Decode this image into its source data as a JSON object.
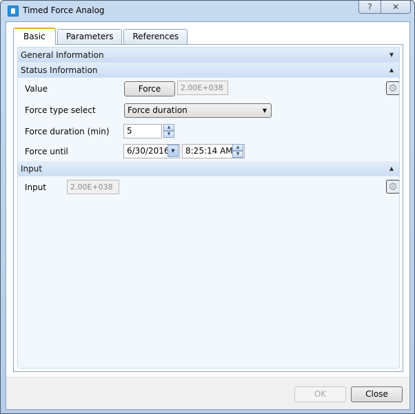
{
  "window": {
    "title": "Timed Force Analog",
    "icon": "app-icon",
    "help_label": "?",
    "close_label": "✕"
  },
  "tabs": [
    {
      "label": "Basic",
      "active": true
    },
    {
      "label": "Parameters",
      "active": false
    },
    {
      "label": "References",
      "active": false
    }
  ],
  "sections": {
    "general": {
      "title": "General Information",
      "state": "collapsed",
      "chevron": "▼"
    },
    "status": {
      "title": "Status Information",
      "state": "expanded",
      "chevron": "▲",
      "value_label": "Value",
      "force_button": "Force",
      "value_field": "2.00E+038",
      "force_type_label": "Force type select",
      "force_type_value": "Force duration",
      "force_duration_label": "Force duration (min)",
      "force_duration_value": "5",
      "force_until_label": "Force until",
      "force_until_date": "6/30/2016",
      "force_until_time": "8:25:14 AM"
    },
    "input": {
      "title": "Input",
      "state": "expanded",
      "chevron": "▲",
      "input_label": "Input",
      "input_value": "2.00E+038"
    }
  },
  "footer": {
    "ok_label": "OK",
    "close_label": "Close"
  },
  "icons": {
    "gear": "⚙",
    "dropdown": "▼",
    "spin_up": "▲",
    "spin_down": "▼"
  }
}
